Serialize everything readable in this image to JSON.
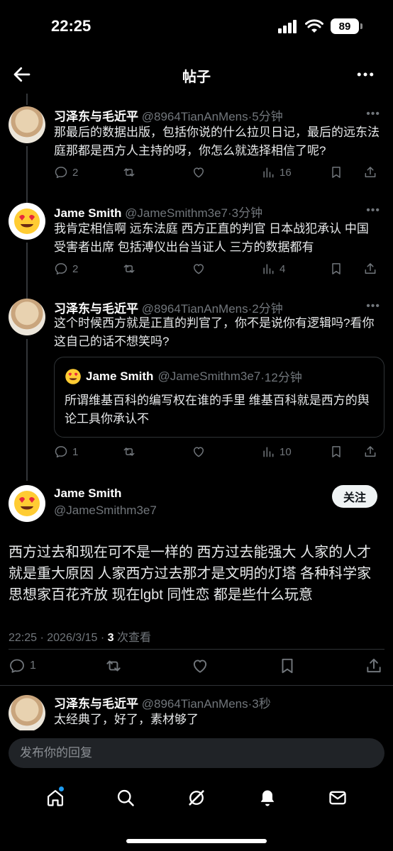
{
  "status_bar": {
    "time": "22:25",
    "battery": "89"
  },
  "header": {
    "title": "帖子"
  },
  "replies": [
    {
      "name": "习泽东与毛近平",
      "handle": "@8964TianAnMens",
      "time": "·5分钟",
      "text": "那最后的数据出版，包括你说的什么拉贝日记，最后的远东法庭那都是西方人主持的呀，你怎么就选择相信了呢?",
      "reply_count": "2",
      "view_count": "16"
    },
    {
      "name": "Jame Smith",
      "handle": "@JameSmithm3e7",
      "time": "·3分钟",
      "text": "我肯定相信啊 远东法庭 西方正直的判官 日本战犯承认 中国受害者出席 包括溥仪出台当证人 三方的数据都有",
      "reply_count": "2",
      "view_count": "4"
    },
    {
      "name": "习泽东与毛近平",
      "handle": "@8964TianAnMens",
      "time": "·2分钟",
      "text": "这个时候西方就是正直的判官了，你不是说你有逻辑吗?看你这自己的话不想笑吗?",
      "reply_count": "1",
      "view_count": "10",
      "quote": {
        "name": "Jame Smith",
        "handle": "@JameSmithm3e7",
        "time": "·12分钟",
        "text": "所谓维基百科的编写权在谁的手里 维基百科就是西方的舆论工具你承认不"
      }
    }
  ],
  "main_tweet": {
    "name": "Jame Smith",
    "handle": "@JameSmithm3e7",
    "follow_label": "关注",
    "text": "西方过去和现在可不是一样的 西方过去能强大 人家的人才就是重大原因 人家西方过去那才是文明的灯塔 各种科学家思想家百花齐放 现在lgbt 同性恋 都是些什么玩意",
    "timestamp": "22:25 · 2026/3/15 · ",
    "views": "3",
    "views_label": " 次查看",
    "reply_count": "1"
  },
  "last_reply": {
    "name": "习泽东与毛近平",
    "handle": "@8964TianAnMens",
    "time": "·3秒",
    "text": "太经典了，好了，素材够了"
  },
  "composer": {
    "placeholder": "发布你的回复"
  },
  "nav": [
    "home-icon",
    "search-icon",
    "grok-icon",
    "notifications-icon",
    "messages-icon"
  ],
  "colors": {
    "background": "#000000",
    "text": "#e7e9ea",
    "muted": "#71767b",
    "accent": "#1d9bf0"
  }
}
